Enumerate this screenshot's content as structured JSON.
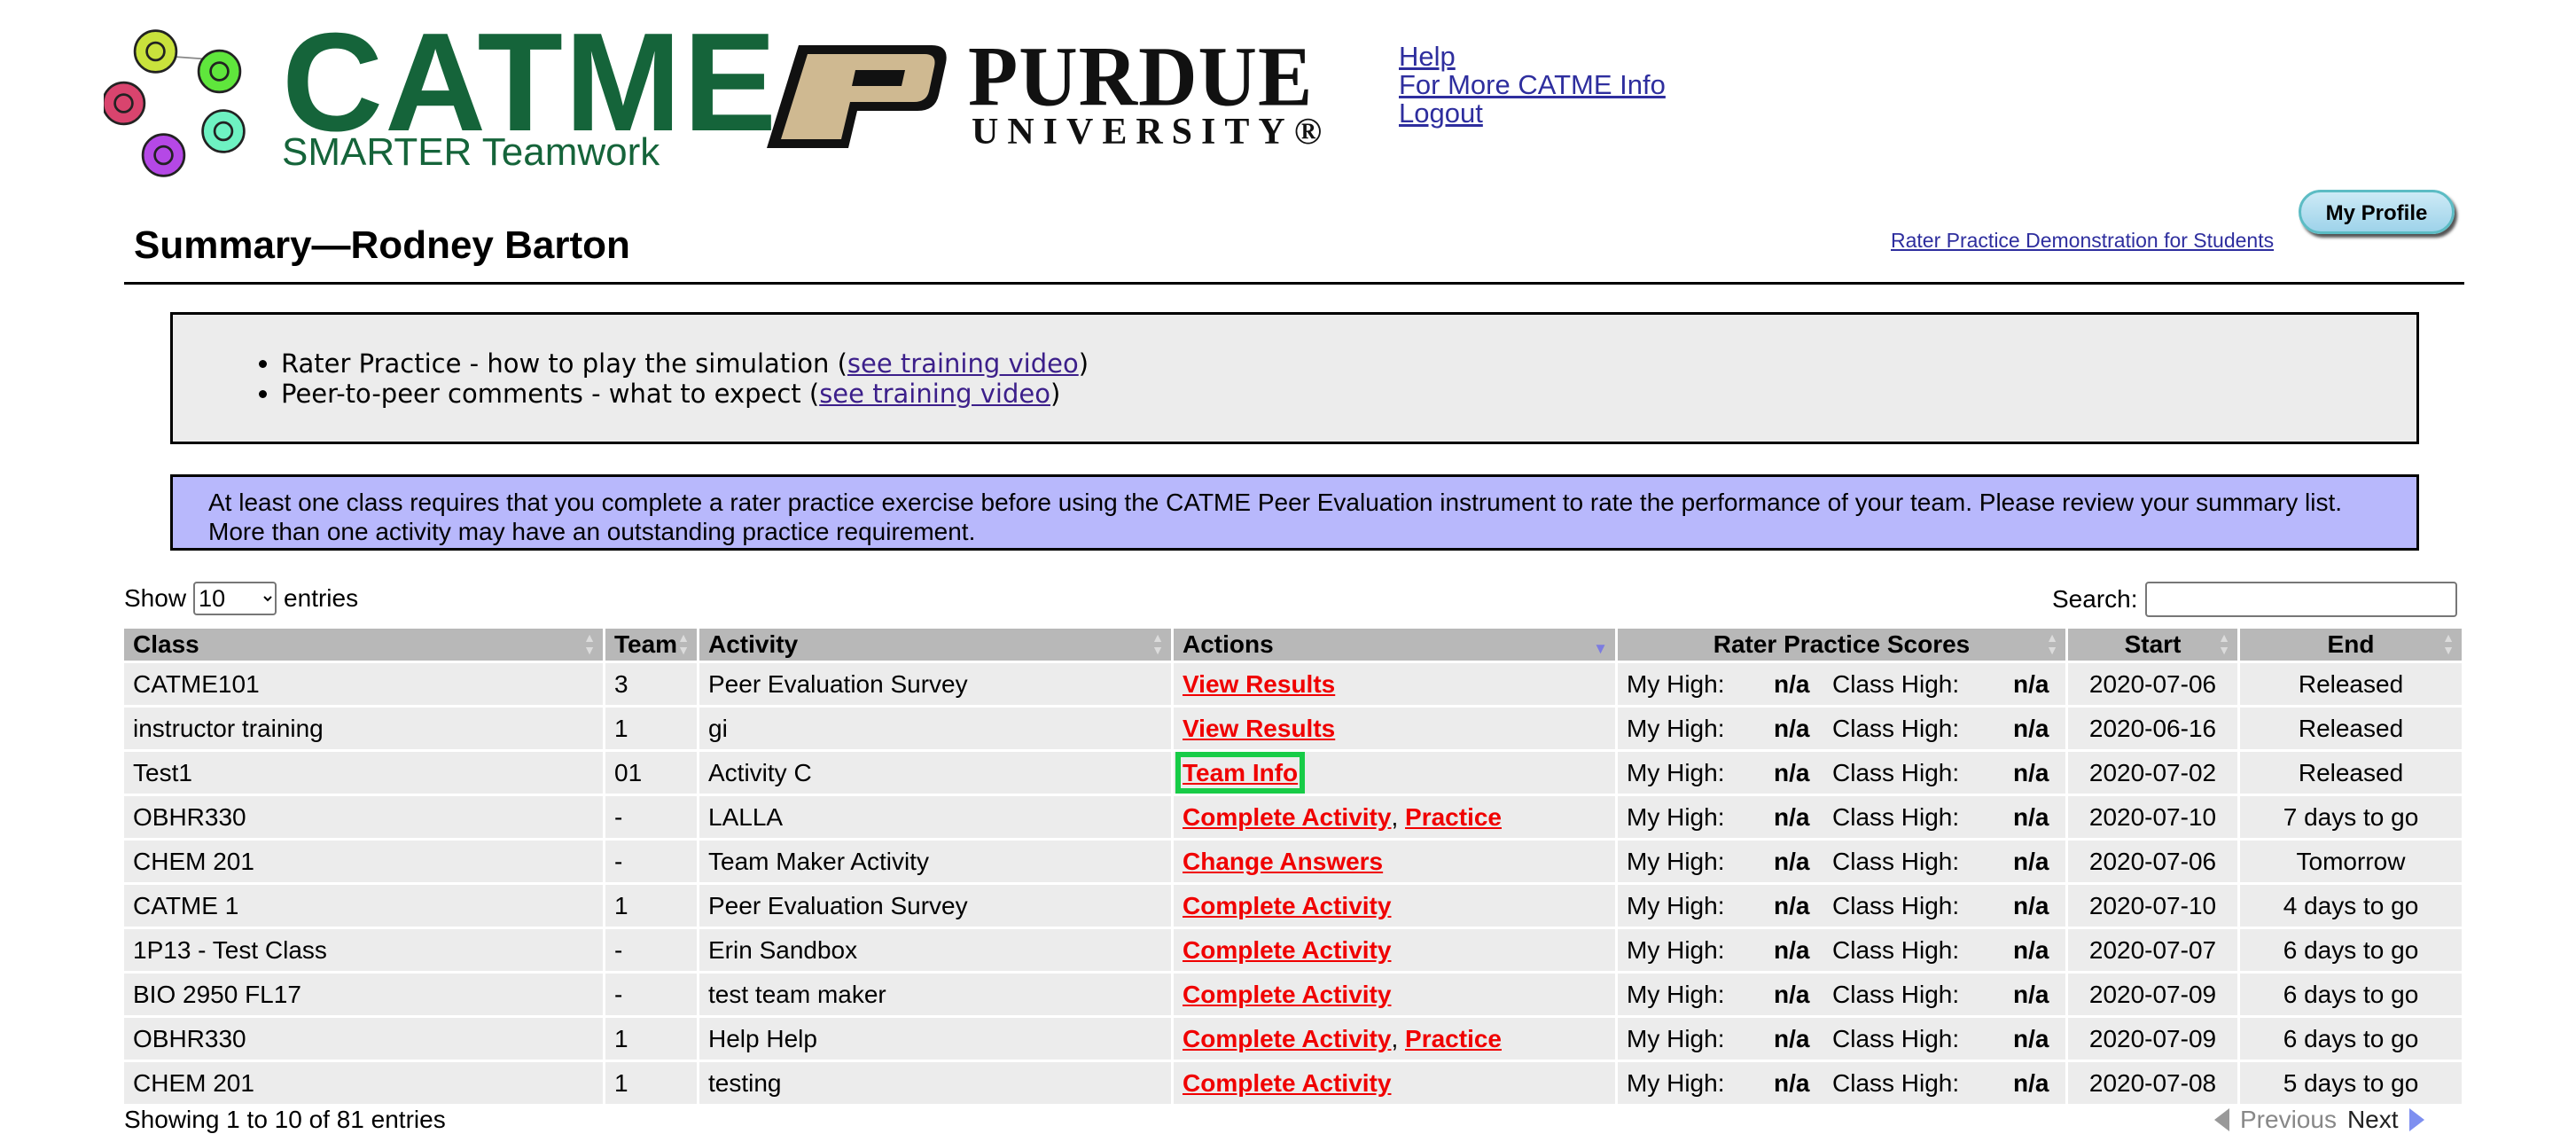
{
  "branding": {
    "catme_word": "CATME",
    "catme_tagline": "SMARTER Teamwork",
    "purdue_name": "PURDUE",
    "purdue_univ": "UNIVERSITY®"
  },
  "header_links": [
    "Help",
    "For More CATME Info",
    "Logout"
  ],
  "my_profile_label": "My Profile",
  "rater_demo_link": "Rater Practice Demonstration for Students",
  "page_title": "Summary—Rodney Barton",
  "training": [
    {
      "text": "Rater Practice - how to play the simulation (",
      "link": "see training video",
      "after": ")"
    },
    {
      "text": "Peer-to-peer comments - what to expect (",
      "link": "see training video",
      "after": ")"
    }
  ],
  "notice": "At least one class requires that you complete a rater practice exercise before using the CATME Peer Evaluation instrument to rate the performance of your team. Please review your summary list. More than one activity may have an outstanding practice requirement.",
  "length_menu": {
    "show": "Show",
    "value": "10",
    "entries": "entries"
  },
  "search": {
    "label": "Search:",
    "value": ""
  },
  "columns": [
    "Class",
    "Team",
    "Activity",
    "Actions",
    "Rater Practice Scores",
    "Start",
    "End"
  ],
  "score_labels": {
    "my_high": "My High:",
    "class_high": "Class High:"
  },
  "rows": [
    {
      "class": "CATME101",
      "team": "3",
      "activity": "Peer Evaluation Survey",
      "actions": [
        "View Results"
      ],
      "my_high": "n/a",
      "class_high": "n/a",
      "start": "2020-07-06",
      "end": "Released"
    },
    {
      "class": "instructor training",
      "team": "1",
      "activity": "gi",
      "actions": [
        "View Results"
      ],
      "my_high": "n/a",
      "class_high": "n/a",
      "start": "2020-06-16",
      "end": "Released"
    },
    {
      "class": "Test1",
      "team": "01",
      "activity": "Activity C",
      "actions": [
        "Team Info"
      ],
      "highlighted": true,
      "my_high": "n/a",
      "class_high": "n/a",
      "start": "2020-07-02",
      "end": "Released"
    },
    {
      "class": "OBHR330",
      "team": "-",
      "activity": "LALLA",
      "actions": [
        "Complete Activity",
        "Practice"
      ],
      "my_high": "n/a",
      "class_high": "n/a",
      "start": "2020-07-10",
      "end": "7 days to go"
    },
    {
      "class": "CHEM 201",
      "team": "-",
      "activity": "Team Maker Activity",
      "actions": [
        "Change Answers"
      ],
      "my_high": "n/a",
      "class_high": "n/a",
      "start": "2020-07-06",
      "end": "Tomorrow"
    },
    {
      "class": "CATME 1",
      "team": "1",
      "activity": "Peer Evaluation Survey",
      "actions": [
        "Complete Activity"
      ],
      "my_high": "n/a",
      "class_high": "n/a",
      "start": "2020-07-10",
      "end": "4 days to go"
    },
    {
      "class": "1P13 - Test Class",
      "team": "-",
      "activity": "Erin Sandbox",
      "actions": [
        "Complete Activity"
      ],
      "my_high": "n/a",
      "class_high": "n/a",
      "start": "2020-07-07",
      "end": "6 days to go"
    },
    {
      "class": "BIO 2950 FL17",
      "team": "-",
      "activity": "test team maker",
      "actions": [
        "Complete Activity"
      ],
      "my_high": "n/a",
      "class_high": "n/a",
      "start": "2020-07-09",
      "end": "6 days to go"
    },
    {
      "class": "OBHR330",
      "team": "1",
      "activity": "Help Help",
      "actions": [
        "Complete Activity",
        "Practice"
      ],
      "my_high": "n/a",
      "class_high": "n/a",
      "start": "2020-07-09",
      "end": "6 days to go"
    },
    {
      "class": "CHEM 201",
      "team": "1",
      "activity": "testing",
      "actions": [
        "Complete Activity"
      ],
      "my_high": "n/a",
      "class_high": "n/a",
      "start": "2020-07-08",
      "end": "5 days to go"
    }
  ],
  "table_info": "Showing 1 to 10 of 81 entries",
  "pager": {
    "previous": "Previous",
    "next": "Next"
  },
  "colors": {
    "catme_green": "#15643a",
    "action_red": "#f00000",
    "notice_bg": "#b8b8fc",
    "highlight": "#17cc47"
  }
}
